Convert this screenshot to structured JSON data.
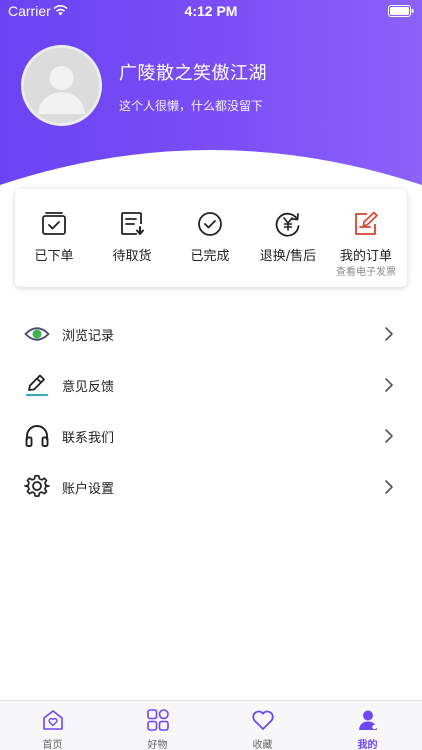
{
  "status_bar": {
    "carrier": "Carrier",
    "time": "4:12 PM"
  },
  "profile": {
    "name": "广陵散之笑傲江湖",
    "bio": "这个人很懒，什么都没留下"
  },
  "orders": [
    {
      "label": "已下单",
      "icon": "cart-check-icon"
    },
    {
      "label": "待取货",
      "icon": "pickup-icon"
    },
    {
      "label": "已完成",
      "icon": "check-circle-icon"
    },
    {
      "label": "退换/售后",
      "icon": "refund-icon"
    },
    {
      "label": "我的订单",
      "sub": "查看电子发票",
      "icon": "edit-order-icon"
    }
  ],
  "menu": [
    {
      "label": "浏览记录",
      "icon": "eye-icon"
    },
    {
      "label": "意见反馈",
      "icon": "pen-icon"
    },
    {
      "label": "联系我们",
      "icon": "headphones-icon"
    },
    {
      "label": "账户设置",
      "icon": "gear-icon"
    }
  ],
  "tabbar": [
    {
      "label": "首页",
      "icon": "home-icon"
    },
    {
      "label": "好物",
      "icon": "grid-icon"
    },
    {
      "label": "收藏",
      "icon": "heart-icon"
    },
    {
      "label": "我的",
      "icon": "user-icon",
      "active": true
    }
  ],
  "colors": {
    "accent": "#6d48f4",
    "header_start": "#6a43f3",
    "header_end": "#8c62f8",
    "order_icon_red": "#d9432f"
  }
}
